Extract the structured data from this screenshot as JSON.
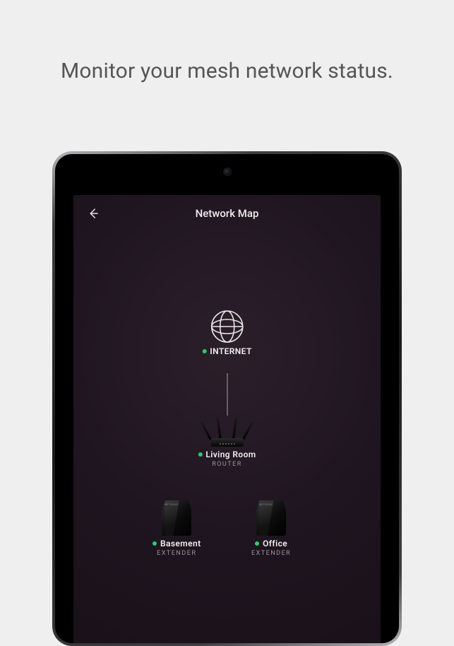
{
  "promo": {
    "caption": "Monitor your mesh network status."
  },
  "app": {
    "header": {
      "title": "Network Map"
    }
  },
  "nodes": {
    "internet": {
      "name": "INTERNET",
      "status_color": "#2ecc71"
    },
    "router": {
      "name": "Living Room",
      "role": "ROUTER",
      "status_color": "#2ecc71"
    },
    "ext1": {
      "name": "Basement",
      "role": "EXTENDER",
      "status_color": "#2ecc71"
    },
    "ext2": {
      "name": "Office",
      "role": "EXTENDER",
      "status_color": "#2ecc71"
    }
  }
}
